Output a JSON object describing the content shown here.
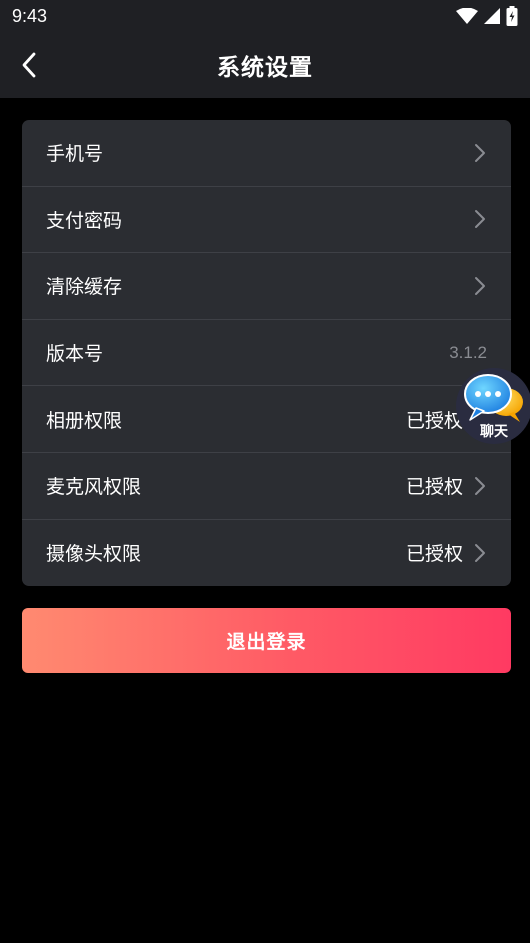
{
  "status_bar": {
    "time": "9:43"
  },
  "header": {
    "title": "系统设置"
  },
  "settings": [
    {
      "label": "手机号",
      "value": ""
    },
    {
      "label": "支付密码",
      "value": ""
    },
    {
      "label": "清除缓存",
      "value": ""
    },
    {
      "label": "版本号",
      "value": "3.1.2"
    },
    {
      "label": "相册权限",
      "value": "已授权"
    },
    {
      "label": "麦克风权限",
      "value": "已授权"
    },
    {
      "label": "摄像头权限",
      "value": "已授权"
    }
  ],
  "logout": {
    "label": "退出登录"
  },
  "chat_float": {
    "label": "聊天"
  },
  "colors": {
    "background": "#000000",
    "bar": "#1f2024",
    "card": "#2b2d32",
    "accent_start": "#ff8a70",
    "accent_end": "#ff3a62"
  }
}
